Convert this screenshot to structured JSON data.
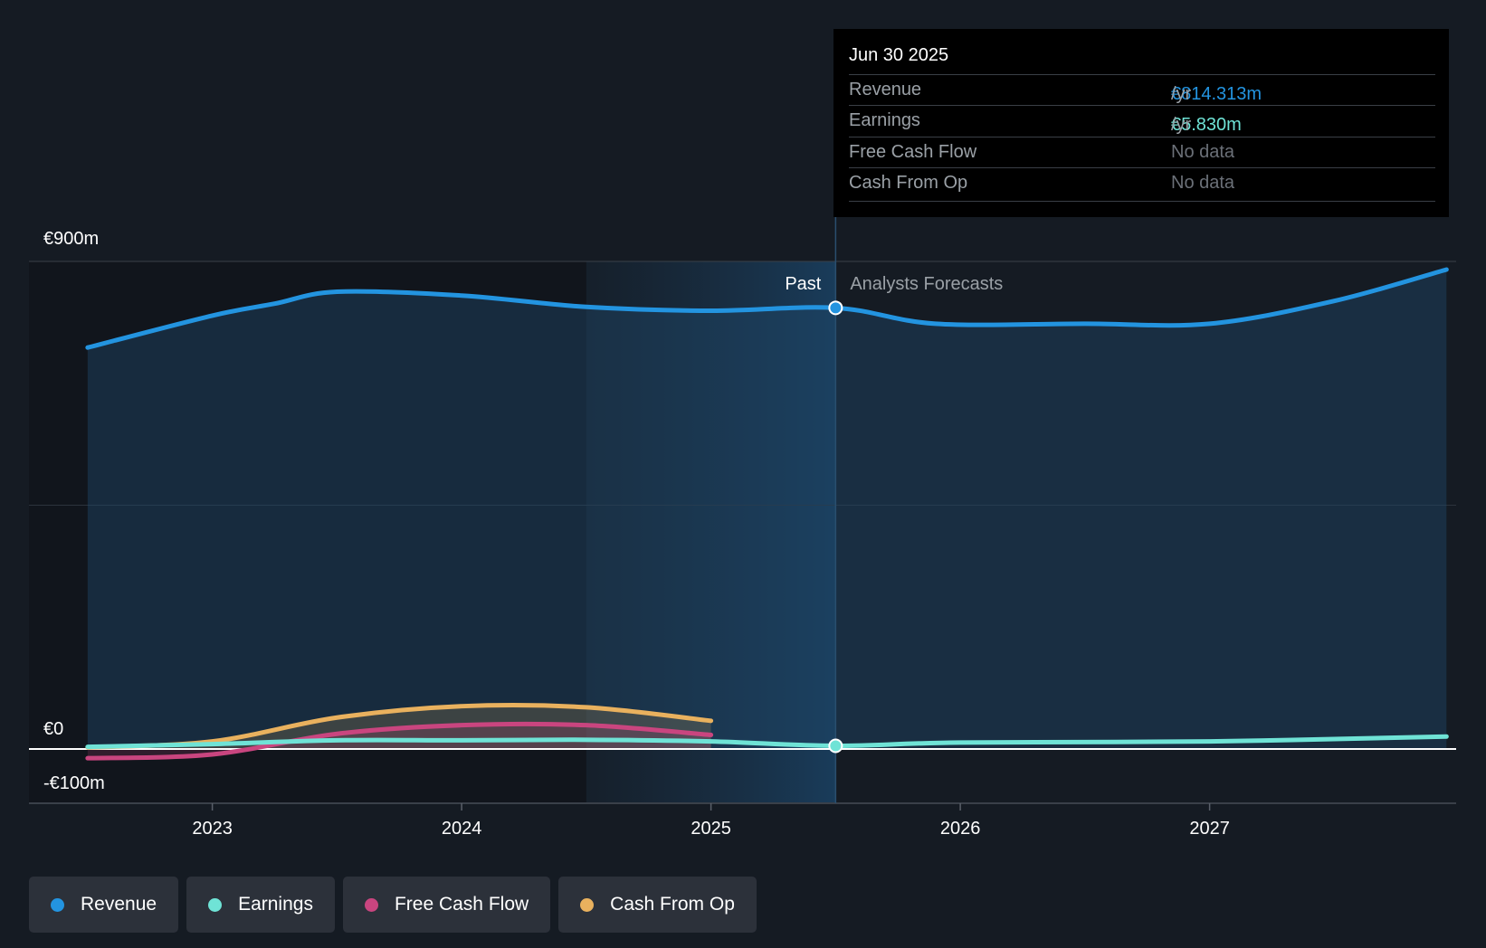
{
  "chart_data": {
    "type": "area",
    "title": "",
    "y_ticks": [
      {
        "value": 900,
        "label": "€900m"
      },
      {
        "value": 0,
        "label": "€0"
      },
      {
        "value": -100,
        "label": "-€100m"
      }
    ],
    "ylim": [
      -100,
      900
    ],
    "xlim": [
      2022.4,
      2027.96
    ],
    "x_ticks": [
      {
        "value": 2023,
        "label": "2023"
      },
      {
        "value": 2024,
        "label": "2024"
      },
      {
        "value": 2025,
        "label": "2025"
      },
      {
        "value": 2026,
        "label": "2026"
      },
      {
        "value": 2027,
        "label": "2027"
      }
    ],
    "past_boundary": 2025.5,
    "past_label": "Past",
    "forecast_label": "Analysts Forecasts",
    "series": [
      {
        "name": "Revenue",
        "color": "#2394e0",
        "x": [
          2022.5,
          2023,
          2023.25,
          2023.5,
          2024,
          2024.5,
          2025,
          2025.5,
          2025.9,
          2026.5,
          2027,
          2027.5,
          2027.95
        ],
        "values": [
          741,
          800,
          822,
          844,
          837,
          816,
          809,
          814.3,
          785,
          785,
          785,
          827,
          885
        ]
      },
      {
        "name": "Earnings",
        "color": "#6fe3d6",
        "x": [
          2022.5,
          2023,
          2023.5,
          2024,
          2024.5,
          2025,
          2025.5,
          2026,
          2027,
          2027.95
        ],
        "values": [
          4,
          9,
          16,
          16,
          17,
          14,
          5.8,
          12,
          14,
          23
        ]
      },
      {
        "name": "Free Cash Flow",
        "color": "#c9457f",
        "x": [
          2022.5,
          2023,
          2023.5,
          2024,
          2024.5,
          2025
        ],
        "values": [
          -17,
          -10,
          28,
          44,
          44,
          26
        ]
      },
      {
        "name": "Cash From Op",
        "color": "#e9b15e",
        "x": [
          2022.5,
          2023,
          2023.5,
          2024,
          2024.5,
          2025
        ],
        "values": [
          3,
          14,
          58,
          79,
          77,
          52
        ]
      }
    ]
  },
  "tooltip": {
    "date": "Jun 30 2025",
    "rows": [
      {
        "label": "Revenue",
        "value": "€814.313m",
        "unit": "/yr",
        "color": "#2394e0"
      },
      {
        "label": "Earnings",
        "value": "€5.830m",
        "unit": "/yr",
        "color": "#6fe3d6"
      },
      {
        "label": "Free Cash Flow",
        "value": "No data",
        "unit": "",
        "color": "#6b7078"
      },
      {
        "label": "Cash From Op",
        "value": "No data",
        "unit": "",
        "color": "#6b7078"
      }
    ]
  },
  "legend": [
    {
      "label": "Revenue",
      "color": "#2394e0"
    },
    {
      "label": "Earnings",
      "color": "#6fe3d6"
    },
    {
      "label": "Free Cash Flow",
      "color": "#c9457f"
    },
    {
      "label": "Cash From Op",
      "color": "#e9b15e"
    }
  ]
}
